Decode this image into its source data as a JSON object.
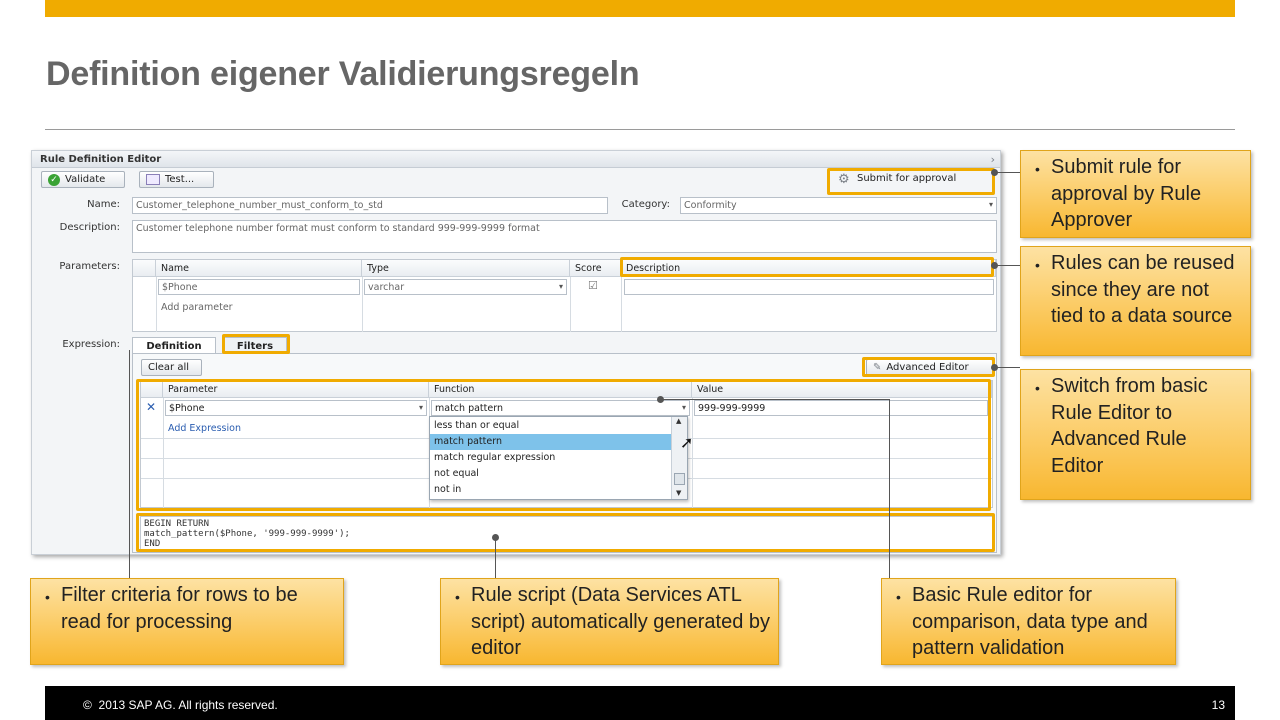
{
  "slide": {
    "title": "Definition eigener Validierungsregeln",
    "footer_copyright": "2013 SAP AG. All rights reserved.",
    "page_number": "13",
    "accent": "#f0ab00"
  },
  "editor": {
    "title": "Rule Definition Editor",
    "validate_label": "Validate",
    "test_label": "Test...",
    "submit_label": "Submit for approval",
    "name_label": "Name:",
    "name_value": "Customer_telephone_number_must_conform_to_std",
    "category_label": "Category:",
    "category_value": "Conformity",
    "description_label": "Description:",
    "description_value": "Customer telephone number format must conform to standard 999-999-9999 format",
    "parameters_label": "Parameters:",
    "param_columns": [
      "Name",
      "Type",
      "Score",
      "Description"
    ],
    "param_row": {
      "name": "$Phone",
      "type": "varchar"
    },
    "add_parameter": "Add parameter",
    "expression_label": "Expression:",
    "tabs": [
      "Definition",
      "Filters"
    ],
    "clear_all": "Clear all",
    "advanced_editor": "Advanced Editor",
    "expr_columns": [
      "Parameter",
      "Function",
      "Value"
    ],
    "expr_row": {
      "parameter": "$Phone",
      "function": "match pattern",
      "value": "999-999-9999"
    },
    "add_expression": "Add Expression",
    "function_options": [
      "less than or equal",
      "match pattern",
      "match regular expression",
      "not equal",
      "not in"
    ],
    "selected_function_index": 1,
    "script_lines": [
      "BEGIN RETURN",
      "match_pattern($Phone, '999-999-9999');",
      "END"
    ]
  },
  "callouts": {
    "submit": "Submit rule for approval by Rule Approver",
    "reuse": "Rules can be reused since they are not tied to a data source",
    "advanced": "Switch from basic Rule  Editor to Advanced Rule Editor",
    "filter": "Filter criteria for rows to be read for processing",
    "script": "Rule script (Data Services ATL script) automatically generated by editor",
    "basic": "Basic Rule editor for comparison, data type and pattern validation"
  }
}
